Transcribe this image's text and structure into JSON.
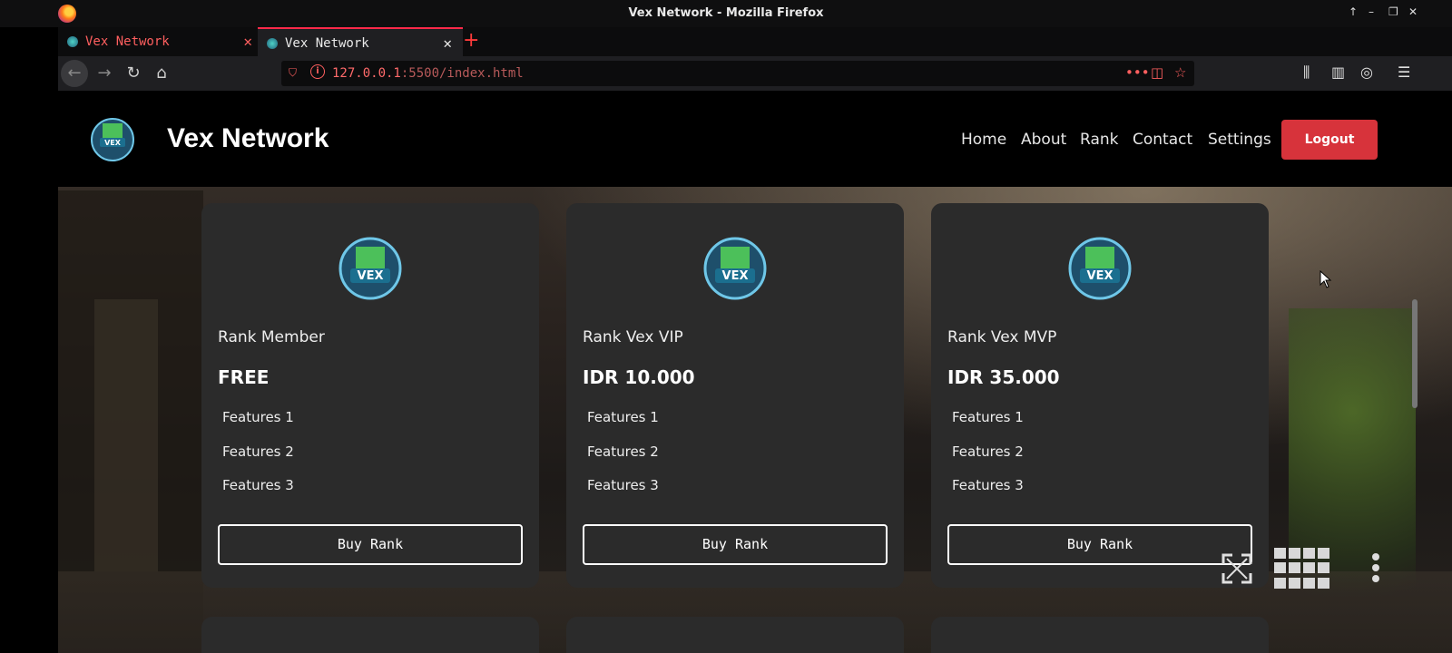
{
  "window": {
    "title": "Vex Network - Mozilla Firefox"
  },
  "tabs": [
    {
      "label": "Vex Network",
      "active": false
    },
    {
      "label": "Vex Network",
      "active": true
    }
  ],
  "address_bar": {
    "host": "127.0.0.1",
    "path": ":5500/index.html"
  },
  "site": {
    "brand": "Vex Network",
    "nav": [
      "Home",
      "About",
      "Rank",
      "Contact",
      "Settings"
    ],
    "logout_label": "Logout",
    "colors": {
      "logout_bg": "#d7333b",
      "card_bg": "#2b2b2b",
      "header_bg": "#000000"
    }
  },
  "cards": [
    {
      "title": "Rank Member",
      "price": "FREE",
      "features": [
        "Features 1",
        "Features 2",
        "Features 3"
      ],
      "button": "Buy Rank"
    },
    {
      "title": "Rank Vex VIP",
      "price": "IDR 10.000",
      "features": [
        "Features 1",
        "Features 2",
        "Features 3"
      ],
      "button": "Buy Rank"
    },
    {
      "title": "Rank Vex MVP",
      "price": "IDR 35.000",
      "features": [
        "Features 1",
        "Features 2",
        "Features 3"
      ],
      "button": "Buy Rank"
    }
  ],
  "icons": {
    "logo": "vex-network-logo",
    "overlay": [
      "expand-icon",
      "grid-icon",
      "more-dots-icon"
    ]
  }
}
